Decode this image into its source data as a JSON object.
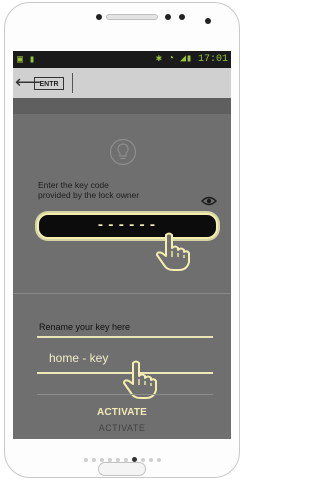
{
  "statusbar": {
    "left_icons": "▣ ▮",
    "right_text": "✱ ◔ ◢▮ 17:01"
  },
  "appbar": {
    "back_glyph": "⟵",
    "logo_text": "ENTR"
  },
  "keycode": {
    "prompt_line1": "Enter the key code",
    "prompt_line2": "provided by the lock owner",
    "value": "------"
  },
  "rename": {
    "label": "Rename your key here",
    "value": "home - key"
  },
  "actions": {
    "activate_label": "ACTIVATE",
    "activate_ghost_label": "ACTIVATE"
  },
  "pager": {
    "count": 10,
    "active_index": 6
  },
  "colors": {
    "highlight": "#f3eeb0",
    "screen_overlay": "#6f6f6f",
    "appbar": "#d0d0d0",
    "status_accent": "#9ac33c"
  },
  "icons": [
    "lightbulb-icon",
    "eye-icon",
    "back-arrow-icon",
    "pointer-hand-icon"
  ]
}
